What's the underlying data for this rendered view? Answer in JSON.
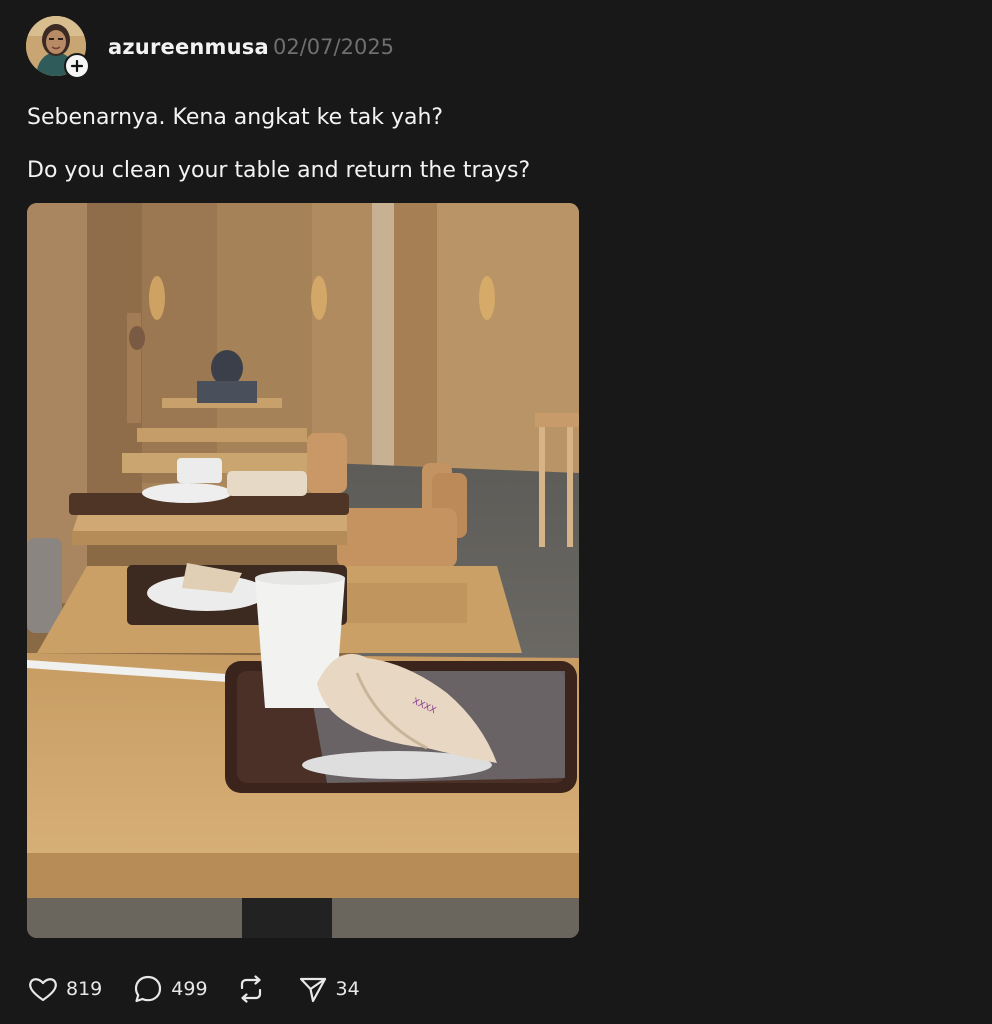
{
  "post": {
    "username": "azureenmusa",
    "date": "02/07/2025",
    "text_line_1": "Sebenarnya. Kena angkat ke tak yah?",
    "text_line_2": "Do you clean your table and return the trays?"
  },
  "actions": {
    "likes": "819",
    "replies": "499",
    "shares": "34"
  },
  "icons": {
    "like": "heart-icon",
    "reply": "comment-icon",
    "repost": "repost-icon",
    "share": "send-icon",
    "follow": "plus-icon"
  },
  "colors": {
    "background": "#181818",
    "text": "#f3f3f3",
    "muted": "#6f6f6f"
  }
}
